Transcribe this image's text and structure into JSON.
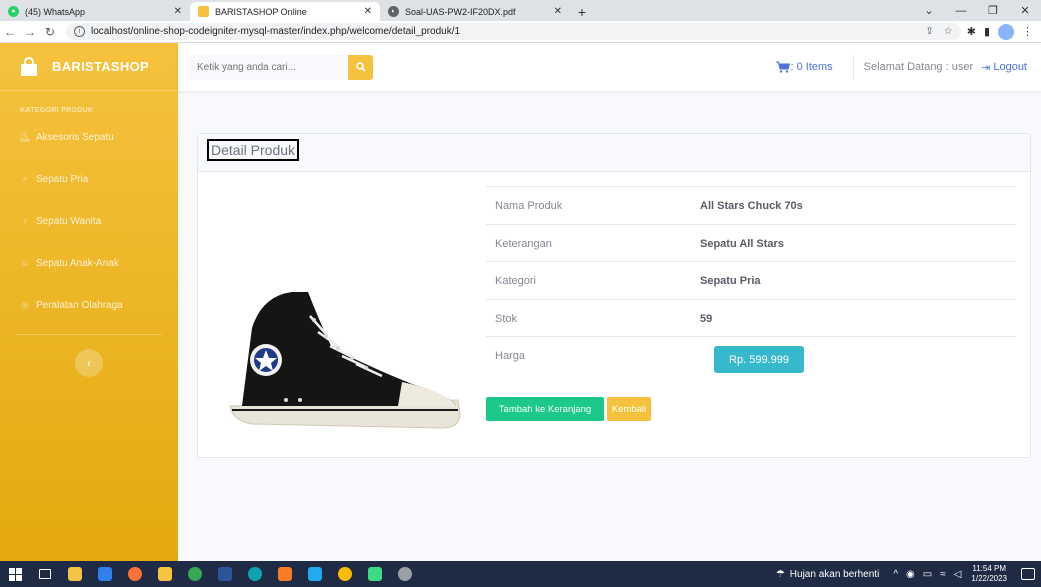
{
  "browser": {
    "tabs": [
      {
        "title": "(45) WhatsApp",
        "color": "#25d366",
        "active": false
      },
      {
        "title": "BARISTASHOP Online",
        "color": "#f6c23e",
        "active": true
      },
      {
        "title": "Soal-UAS-PW2-IF20DX.pdf",
        "color": "#5f6368",
        "active": false
      }
    ],
    "new_tab": "+",
    "url": "localhost/online-shop-codeigniter-mysql-master/index.php/welcome/detail_produk/1"
  },
  "sidebar": {
    "brand": "BARISTASHOP",
    "heading": "KATEGORI PRODUK",
    "items": [
      {
        "label": "Aksesoris Sepatu",
        "icon": "sneaker-icon"
      },
      {
        "label": "Sepatu Pria",
        "icon": "male-icon"
      },
      {
        "label": "Sepatu Wanita",
        "icon": "female-icon"
      },
      {
        "label": "Sepatu Anak-Anak",
        "icon": "child-icon"
      },
      {
        "label": "Peralatan Olahraga",
        "icon": "ball-icon"
      }
    ],
    "colors": {
      "accent": "#f6c23e"
    }
  },
  "topbar": {
    "search_placeholder": "Ketik yang anda cari...",
    "cart_label": ": 0 Items",
    "welcome": "Selamat Datang : user",
    "logout": "Logout"
  },
  "detail": {
    "title": "Detail Produk",
    "rows": [
      {
        "label": "Nama Produk",
        "value": "All Stars Chuck 70s"
      },
      {
        "label": "Keterangan",
        "value": "Sepatu All Stars"
      },
      {
        "label": "Kategori",
        "value": "Sepatu Pria"
      },
      {
        "label": "Stok",
        "value": "59"
      },
      {
        "label": "Harga",
        "value": ""
      }
    ],
    "price": "Rp. 599.999",
    "add_button": "Tambah ke Keranjang",
    "back_button": "Kembali"
  },
  "taskbar": {
    "weather": "Hujan akan berhenti",
    "time": "11:54 PM",
    "date": "1/22/2023"
  }
}
